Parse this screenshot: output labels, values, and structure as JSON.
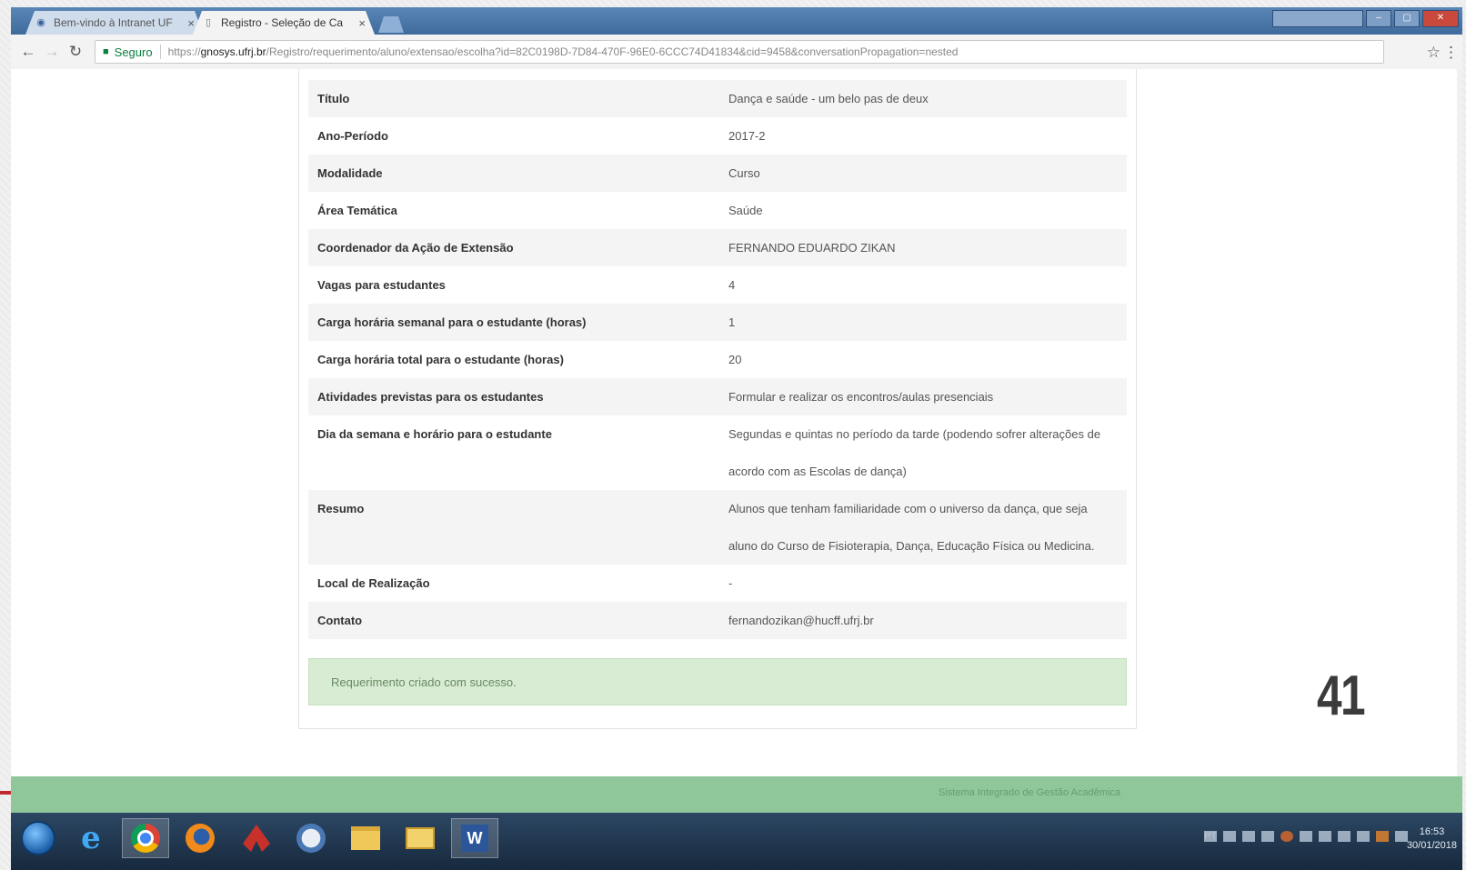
{
  "browser": {
    "tabs": [
      {
        "label": "Bem-vindo à Intranet UF",
        "icon": "globe-icon",
        "active": false,
        "close": "×"
      },
      {
        "label": "Registro - Seleção de Ca",
        "icon": "document-icon",
        "active": true,
        "close": "×"
      }
    ],
    "address": {
      "secure_label": "Seguro",
      "url_prefix": "https://",
      "url_host": "gnosys.ufrj.br",
      "url_path": "/Registro/requerimento/aluno/extensao/escolha?id=82C0198D-7D84-470F-96E0-6CCC74D41834&cid=9458&conversationPropagation=nested"
    }
  },
  "details": {
    "rows": [
      {
        "label": "Título",
        "value": "Dança e saúde - um belo pas de deux"
      },
      {
        "label": "Ano-Período",
        "value": "2017-2"
      },
      {
        "label": "Modalidade",
        "value": "Curso"
      },
      {
        "label": "Área Temática",
        "value": "Saúde"
      },
      {
        "label": "Coordenador da Ação de Extensão",
        "value": "FERNANDO EDUARDO ZIKAN"
      },
      {
        "label": "Vagas para estudantes",
        "value": "4"
      },
      {
        "label": "Carga horária semanal para o estudante (horas)",
        "value": "1"
      },
      {
        "label": "Carga horária total para o estudante (horas)",
        "value": "20"
      },
      {
        "label": "Atividades previstas para os estudantes",
        "value": "Formular e realizar os encontros/aulas presenciais"
      },
      {
        "label": "Dia da semana e horário para o estudante",
        "value": "Segundas e quintas no período da tarde (podendo sofrer alterações de acordo com as Escolas de dança)"
      },
      {
        "label": "Resumo",
        "value": "Alunos que tenham familiaridade com o universo da dança, que seja aluno do Curso de Fisioterapia, Dança, Educação Física ou Medicina."
      },
      {
        "label": "Local de Realização",
        "value": "-"
      },
      {
        "label": "Contato",
        "value": "fernandozikan@hucff.ufrj.br"
      }
    ]
  },
  "alert": {
    "message": "Requerimento criado com sucesso."
  },
  "slide": {
    "page_number": "41"
  },
  "footer": {
    "text": "Sistema Integrado de Gestão Acadêmica"
  },
  "taskbar": {
    "apps": [
      "start-orb",
      "internet-explorer-icon",
      "chrome-icon",
      "firefox-icon",
      "acrobat-icon",
      "network-globe-icon",
      "file-explorer-icon",
      "outlook-icon",
      "word-icon"
    ],
    "tray_language": "PT",
    "clock_time": "16:53",
    "clock_date": "30/01/2018"
  },
  "colors": {
    "footer": "#8fc79a",
    "alert_bg": "#d7ecd3",
    "taskbar": "#1f3550"
  }
}
